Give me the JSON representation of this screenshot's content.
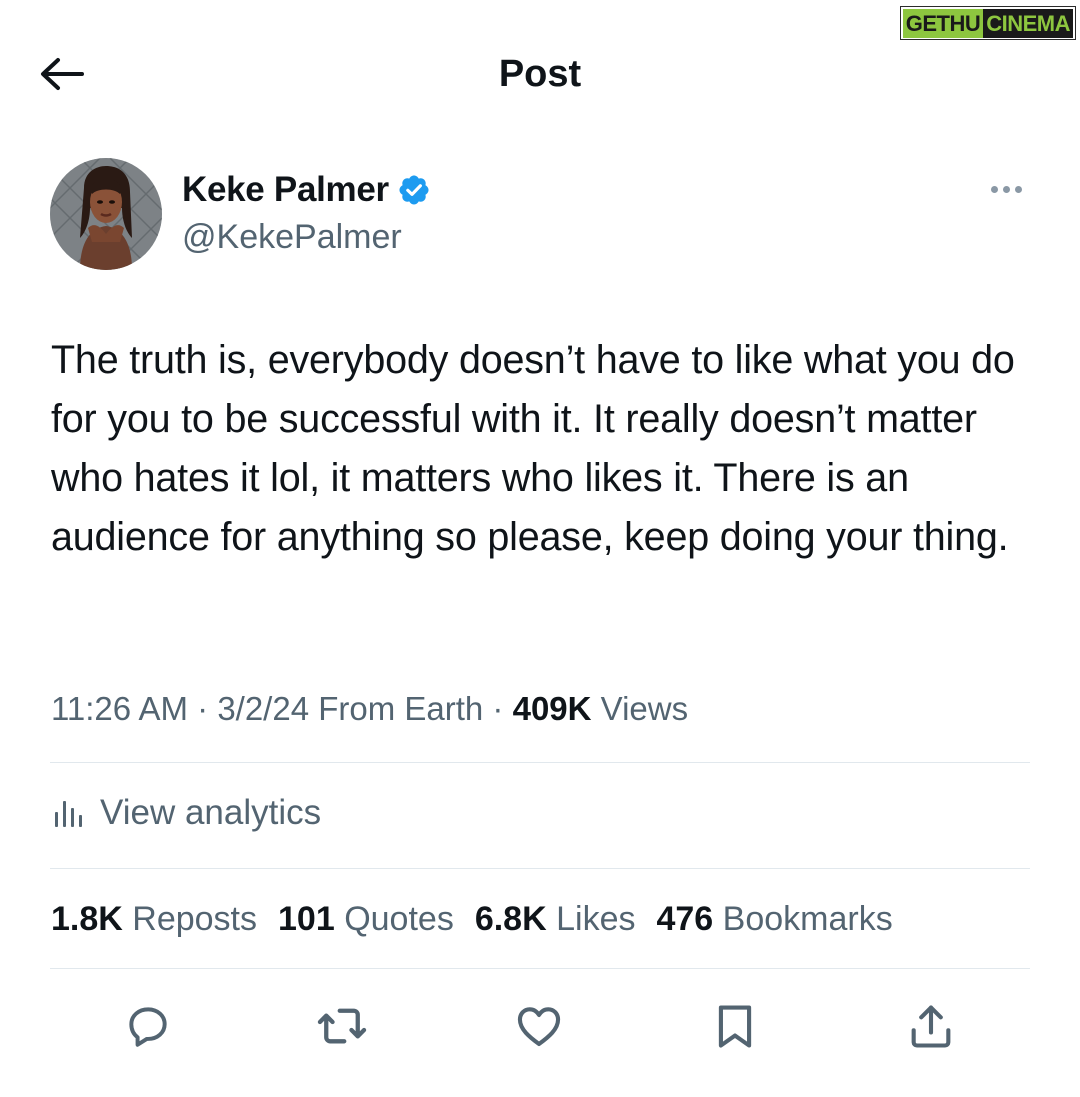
{
  "watermark": {
    "left": "GETHU",
    "right": "CINEMA"
  },
  "header": {
    "title": "Post",
    "back_icon": "arrow-left-icon"
  },
  "author": {
    "display_name": "Keke Palmer",
    "handle": "@KekePalmer",
    "verified_icon": "verified-badge-icon",
    "verified_color": "#1d9bf0"
  },
  "tweet": {
    "text": "The truth is, everybody doesn’t have to like what you do for you to be successful with it. It really doesn’t matter who hates it lol, it matters who likes it. There is an audience for anything so please, keep doing your thing.",
    "time": "11:26 AM",
    "sep1": " · ",
    "date": "3/2/24",
    "source": " From Earth",
    "sep2": " · ",
    "views_count": "409K",
    "views_label": " Views"
  },
  "analytics": {
    "label": "View analytics",
    "icon": "analytics-bars-icon"
  },
  "stats": [
    {
      "count": "1.8K",
      "label": " Reposts"
    },
    {
      "count": "101",
      "label": " Quotes"
    },
    {
      "count": "6.8K",
      "label": " Likes"
    },
    {
      "count": "476",
      "label": " Bookmarks"
    }
  ],
  "actions": [
    "reply-icon",
    "repost-icon",
    "like-icon",
    "bookmark-icon",
    "share-icon"
  ],
  "colors": {
    "text": "#0f1419",
    "secondary": "#536471",
    "divider": "#e1e8ed",
    "accent": "#1d9bf0"
  }
}
